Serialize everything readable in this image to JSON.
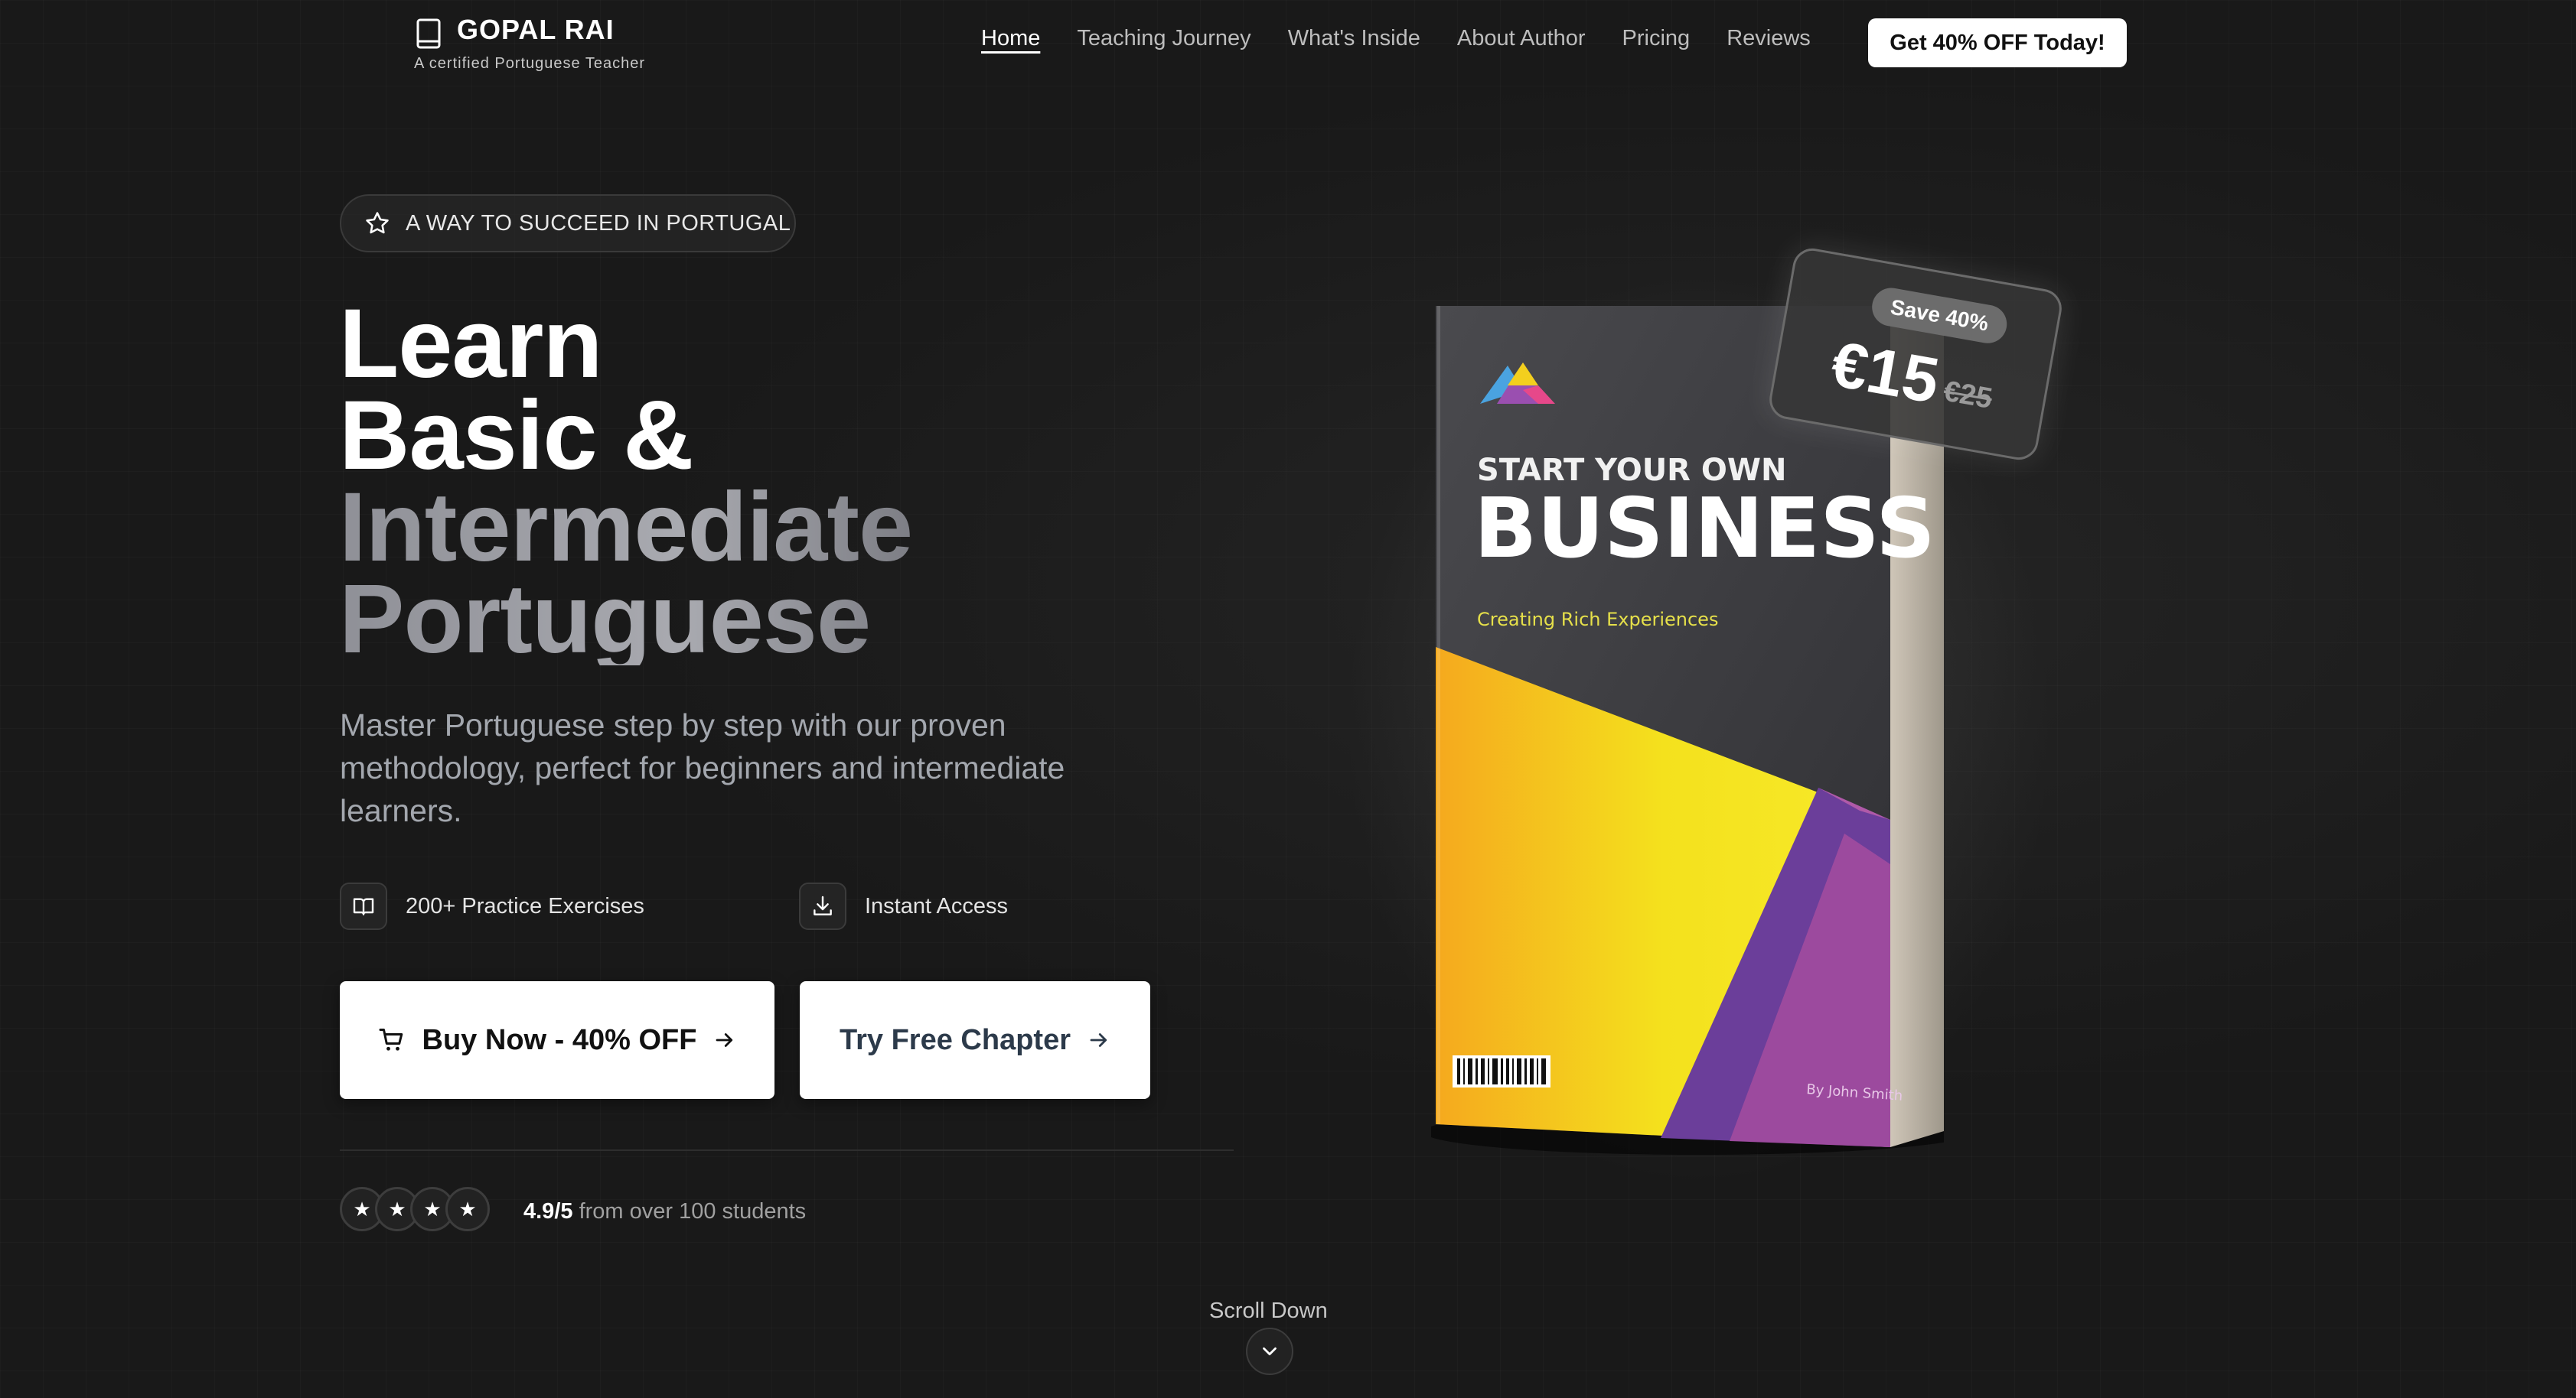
{
  "header": {
    "brand_name": "GOPAL RAI",
    "brand_tagline": "A certified Portuguese Teacher",
    "nav": [
      {
        "label": "Home",
        "active": true
      },
      {
        "label": "Teaching Journey"
      },
      {
        "label": "What's Inside"
      },
      {
        "label": "About Author"
      },
      {
        "label": "Pricing"
      },
      {
        "label": "Reviews"
      }
    ],
    "cta_label": "Get 40% OFF Today!",
    "icon": "book-icon"
  },
  "hero": {
    "badge": {
      "icon": "star-icon",
      "label": "A WAY TO SUCCEED IN PORTUGAL"
    },
    "headline": {
      "line1": "Learn",
      "line2": "Basic &",
      "line3": "Intermediate",
      "line4": "Portuguese"
    },
    "subcopy": "Master Portuguese step by step with our proven methodology, perfect for beginners and intermediate learners.",
    "features": [
      {
        "icon": "open-book-icon",
        "label": "200+ Practice Exercises"
      },
      {
        "icon": "download-icon",
        "label": "Instant Access"
      }
    ],
    "buttons": {
      "buy_label": "Buy Now - 40% OFF",
      "try_label": "Try Free Chapter"
    },
    "rating": {
      "stars": [
        "★",
        "★",
        "★",
        "★"
      ],
      "score": "4.9/5",
      "suffix": "from over 100 students"
    }
  },
  "book": {
    "kicker": "START YOUR OWN",
    "title": "BUSINESS",
    "subtitle": "Creating Rich Experiences",
    "author": "By John Smith"
  },
  "price_card": {
    "save": "Save 40%",
    "price": "€15",
    "old_price": "€25"
  },
  "scroll": {
    "label": "Scroll Down"
  },
  "colors": {
    "background": "#191919",
    "headline_grey": "#a9aab0",
    "book_yellow": "#f2e21e",
    "book_purple": "#7b3fa0",
    "book_magenta": "#a04a9e"
  }
}
